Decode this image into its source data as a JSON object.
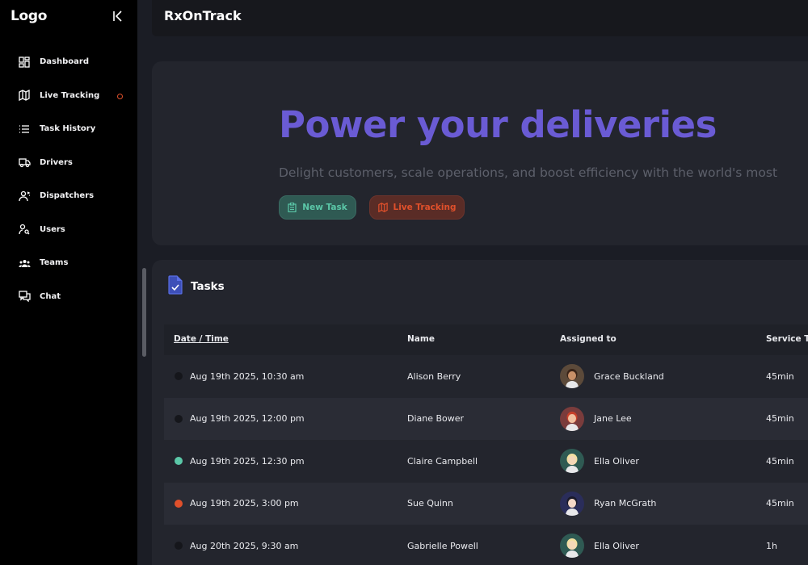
{
  "sidebar": {
    "logo": "Logo",
    "items": [
      {
        "label": "Dashboard",
        "icon": "dashboard-icon"
      },
      {
        "label": "Live Tracking",
        "icon": "map-icon",
        "notification": true
      },
      {
        "label": "Task History",
        "icon": "list-icon"
      },
      {
        "label": "Drivers",
        "icon": "truck-icon"
      },
      {
        "label": "Dispatchers",
        "icon": "dispatcher-icon"
      },
      {
        "label": "Users",
        "icon": "user-search-icon"
      },
      {
        "label": "Teams",
        "icon": "team-icon"
      },
      {
        "label": "Chat",
        "icon": "chat-icon"
      }
    ]
  },
  "header": {
    "title": "RxOnTrack"
  },
  "hero": {
    "title": "Power your deliveries",
    "subtitle": "Delight customers, scale operations, and boost efficiency with the world's most",
    "new_task_label": "New Task",
    "live_tracking_label": "Live Tracking"
  },
  "tasks": {
    "title": "Tasks",
    "columns": [
      "Date / Time",
      "Name",
      "Assigned to",
      "Service T"
    ],
    "rows": [
      {
        "datetime": "Aug 19th 2025, 10:30 am",
        "name": "Alison Berry",
        "assigned": "Grace Buckland",
        "service": "45min",
        "status": "none",
        "avatar": "avatar-brown"
      },
      {
        "datetime": "Aug 19th 2025, 12:00 pm",
        "name": "Diane Bower",
        "assigned": "Jane Lee",
        "service": "45min",
        "status": "none",
        "avatar": "avatar-red"
      },
      {
        "datetime": "Aug 19th 2025, 12:30 pm",
        "name": "Claire Campbell",
        "assigned": "Ella Oliver",
        "service": "45min",
        "status": "green",
        "avatar": "avatar-blonde"
      },
      {
        "datetime": "Aug 19th 2025, 3:00 pm",
        "name": "Sue Quinn",
        "assigned": "Ryan McGrath",
        "service": "45min",
        "status": "orange",
        "avatar": "avatar-dark"
      },
      {
        "datetime": "Aug 20th 2025, 9:30 am",
        "name": "Gabrielle Powell",
        "assigned": "Ella Oliver",
        "service": "1h",
        "status": "none",
        "avatar": "avatar-blonde"
      }
    ]
  },
  "colors": {
    "accent": "#6a5bd4",
    "green": "#5bc8a8",
    "orange": "#e0502b"
  }
}
